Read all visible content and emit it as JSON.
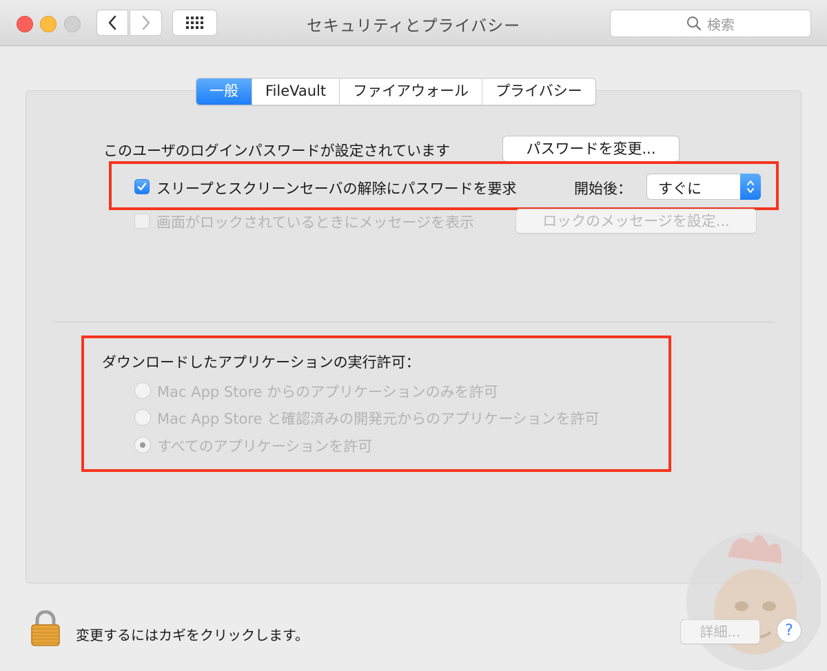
{
  "window": {
    "title": "セキュリティとプライバシー",
    "search_placeholder": "検索"
  },
  "tabs": [
    {
      "label": "一般",
      "active": true
    },
    {
      "label": "FileVault",
      "active": false
    },
    {
      "label": "ファイアウォール",
      "active": false
    },
    {
      "label": "プライバシー",
      "active": false
    }
  ],
  "general": {
    "login_password_text": "このユーザのログインパスワードが設定されています",
    "change_password_button": "パスワードを変更...",
    "require_password": {
      "label": "スリープとスクリーンセーバの解除にパスワードを要求",
      "checked": true,
      "after_label": "開始後：",
      "after_value": "すぐに"
    },
    "lock_message": {
      "label": "画面がロックされているときにメッセージを表示",
      "checked": false,
      "button": "ロックのメッセージを設定..."
    }
  },
  "downloads": {
    "heading": "ダウンロードしたアプリケーションの実行許可：",
    "options": [
      {
        "label": "Mac App Store からのアプリケーションのみを許可",
        "selected": false
      },
      {
        "label": "Mac App Store と確認済みの開発元からのアプリケーションを許可",
        "selected": false
      },
      {
        "label": "すべてのアプリケーションを許可",
        "selected": true
      }
    ]
  },
  "footer": {
    "lock_text": "変更するにはカギをクリックします。",
    "advanced_button": "詳細...",
    "help_label": "?"
  },
  "colors": {
    "accent": "#1d7ef7",
    "highlight_box": "#f5341f",
    "close": "#fc605b",
    "minimize": "#fdbc40"
  }
}
